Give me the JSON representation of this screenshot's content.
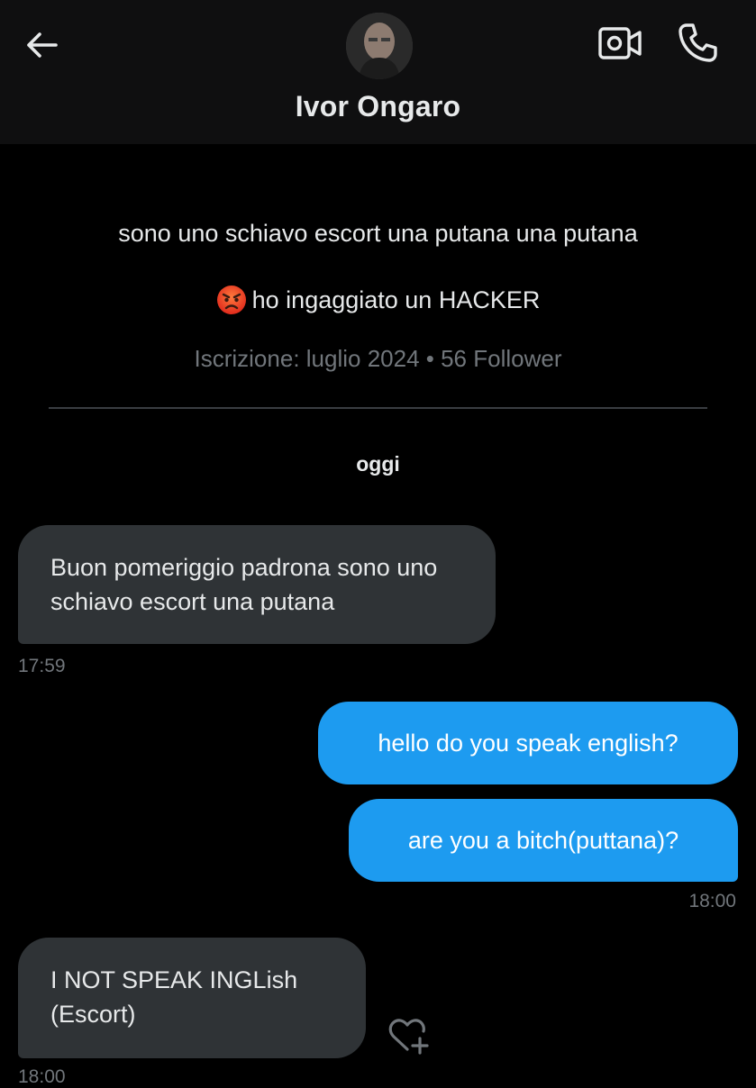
{
  "header": {
    "name": "Ivor Ongaro"
  },
  "profile": {
    "bio": "sono uno schiavo escort una putana una putana",
    "bio_line2": "ho ingaggiato un HACKER",
    "meta": "Iscrizione: luglio 2024 • 56 Follower"
  },
  "conversation": {
    "day": "oggi",
    "messages": [
      {
        "direction": "incoming",
        "text": "Buon pomeriggio padrona sono uno schiavo escort una putana",
        "time": "17:59"
      },
      {
        "direction": "outgoing",
        "text": "hello do you speak english?"
      },
      {
        "direction": "outgoing",
        "text": "are you a bitch(puttana)?",
        "time": "18:00"
      },
      {
        "direction": "incoming",
        "text": "I NOT SPEAK INGLish (Escort)",
        "time": "18:00"
      }
    ]
  },
  "icons": {
    "back": "arrow-left-icon",
    "video": "video-call-icon",
    "phone": "phone-icon",
    "emoji": "angry-face-icon",
    "react": "add-reaction-icon"
  },
  "colors": {
    "background": "#000000",
    "header_bg": "#0f0f10",
    "incoming_bubble": "#2f3336",
    "outgoing_bubble": "#1d9bf0",
    "muted_text": "#71767b"
  }
}
